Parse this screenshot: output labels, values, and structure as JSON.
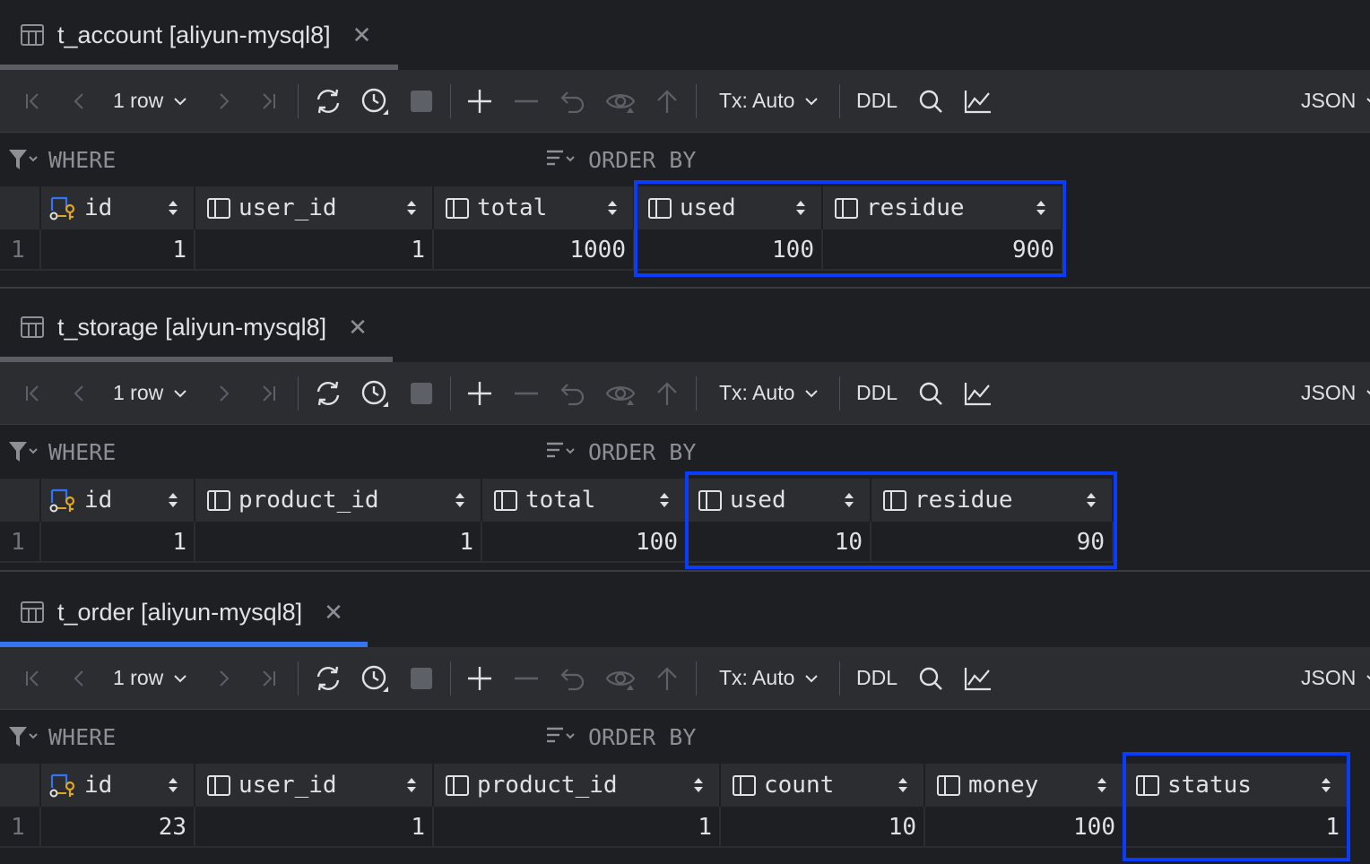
{
  "colors": {
    "highlight": "#0a3cff",
    "active_tab": "#3574f0",
    "background": "#1e1f22",
    "toolbar": "#2b2d30"
  },
  "toolbar": {
    "rows_label": "1 row",
    "tx_label": "Tx: Auto",
    "ddl_label": "DDL",
    "format_label": "JSON",
    "icons": [
      "first-page-icon",
      "previous-page-icon",
      "next-page-icon",
      "last-page-icon",
      "reload-icon",
      "history-icon",
      "stop-icon",
      "add-row-icon",
      "delete-row-icon",
      "revert-icon",
      "preview-icon",
      "submit-icon",
      "search-icon",
      "chart-icon"
    ]
  },
  "filter": {
    "where_label": "WHERE",
    "order_by_label": "ORDER BY"
  },
  "panels": [
    {
      "title": "t_account [aliyun-mysql8]",
      "active": false,
      "row_number": "1",
      "columns": [
        {
          "name": "id",
          "value": "1",
          "key": true
        },
        {
          "name": "user_id",
          "value": "1"
        },
        {
          "name": "total",
          "value": "1000"
        },
        {
          "name": "used",
          "value": "100"
        },
        {
          "name": "residue",
          "value": "900"
        }
      ]
    },
    {
      "title": "t_storage [aliyun-mysql8]",
      "active": false,
      "row_number": "1",
      "columns": [
        {
          "name": "id",
          "value": "1",
          "key": true
        },
        {
          "name": "product_id",
          "value": "1"
        },
        {
          "name": "total",
          "value": "100"
        },
        {
          "name": "used",
          "value": "10"
        },
        {
          "name": "residue",
          "value": "90"
        }
      ]
    },
    {
      "title": "t_order [aliyun-mysql8]",
      "active": true,
      "row_number": "1",
      "columns": [
        {
          "name": "id",
          "value": "23",
          "key": true
        },
        {
          "name": "user_id",
          "value": "1"
        },
        {
          "name": "product_id",
          "value": "1"
        },
        {
          "name": "count",
          "value": "10"
        },
        {
          "name": "money",
          "value": "100"
        },
        {
          "name": "status",
          "value": "1"
        }
      ]
    }
  ]
}
